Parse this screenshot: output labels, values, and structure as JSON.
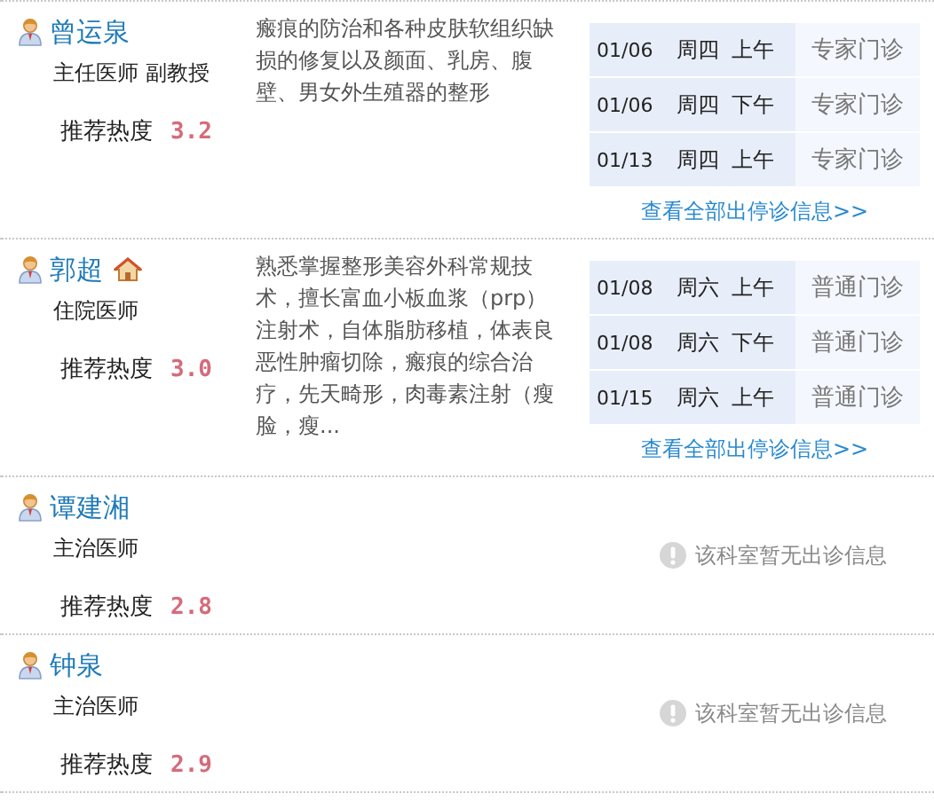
{
  "doctors": [
    {
      "name": "曾运泉",
      "title": "主任医师 副教授",
      "has_home_icon": false,
      "rating_label": "推荐热度",
      "rating": "3.2",
      "description": "瘢痕的防治和各种皮肤软组织缺损的修复以及颜面、乳房、腹壁、男女外生殖器的整形",
      "schedule": [
        {
          "date": "01/06",
          "weekday": "周四",
          "period": "上午",
          "type": "专家门诊"
        },
        {
          "date": "01/06",
          "weekday": "周四",
          "period": "下午",
          "type": "专家门诊"
        },
        {
          "date": "01/13",
          "weekday": "周四",
          "period": "上午",
          "type": "专家门诊"
        }
      ],
      "more_link": "查看全部出停诊信息>>"
    },
    {
      "name": "郭超",
      "title": "住院医师",
      "has_home_icon": true,
      "rating_label": "推荐热度",
      "rating": "3.0",
      "description": "熟悉掌握整形美容外科常规技术，擅长富血小板血浆（prp）注射术，自体脂肪移植，体表良恶性肿瘤切除，瘢痕的综合治疗，先天畸形，肉毒素注射（瘦脸，瘦...",
      "schedule": [
        {
          "date": "01/08",
          "weekday": "周六",
          "period": "上午",
          "type": "普通门诊"
        },
        {
          "date": "01/08",
          "weekday": "周六",
          "period": "下午",
          "type": "普通门诊"
        },
        {
          "date": "01/15",
          "weekday": "周六",
          "period": "上午",
          "type": "普通门诊"
        }
      ],
      "more_link": "查看全部出停诊信息>>"
    },
    {
      "name": "谭建湘",
      "title": "主治医师",
      "has_home_icon": false,
      "rating_label": "推荐热度",
      "rating": "2.8",
      "no_schedule": "该科室暂无出诊信息"
    },
    {
      "name": "钟泉",
      "title": "主治医师",
      "has_home_icon": false,
      "rating_label": "推荐热度",
      "rating": "2.9",
      "no_schedule": "该科室暂无出诊信息"
    }
  ]
}
